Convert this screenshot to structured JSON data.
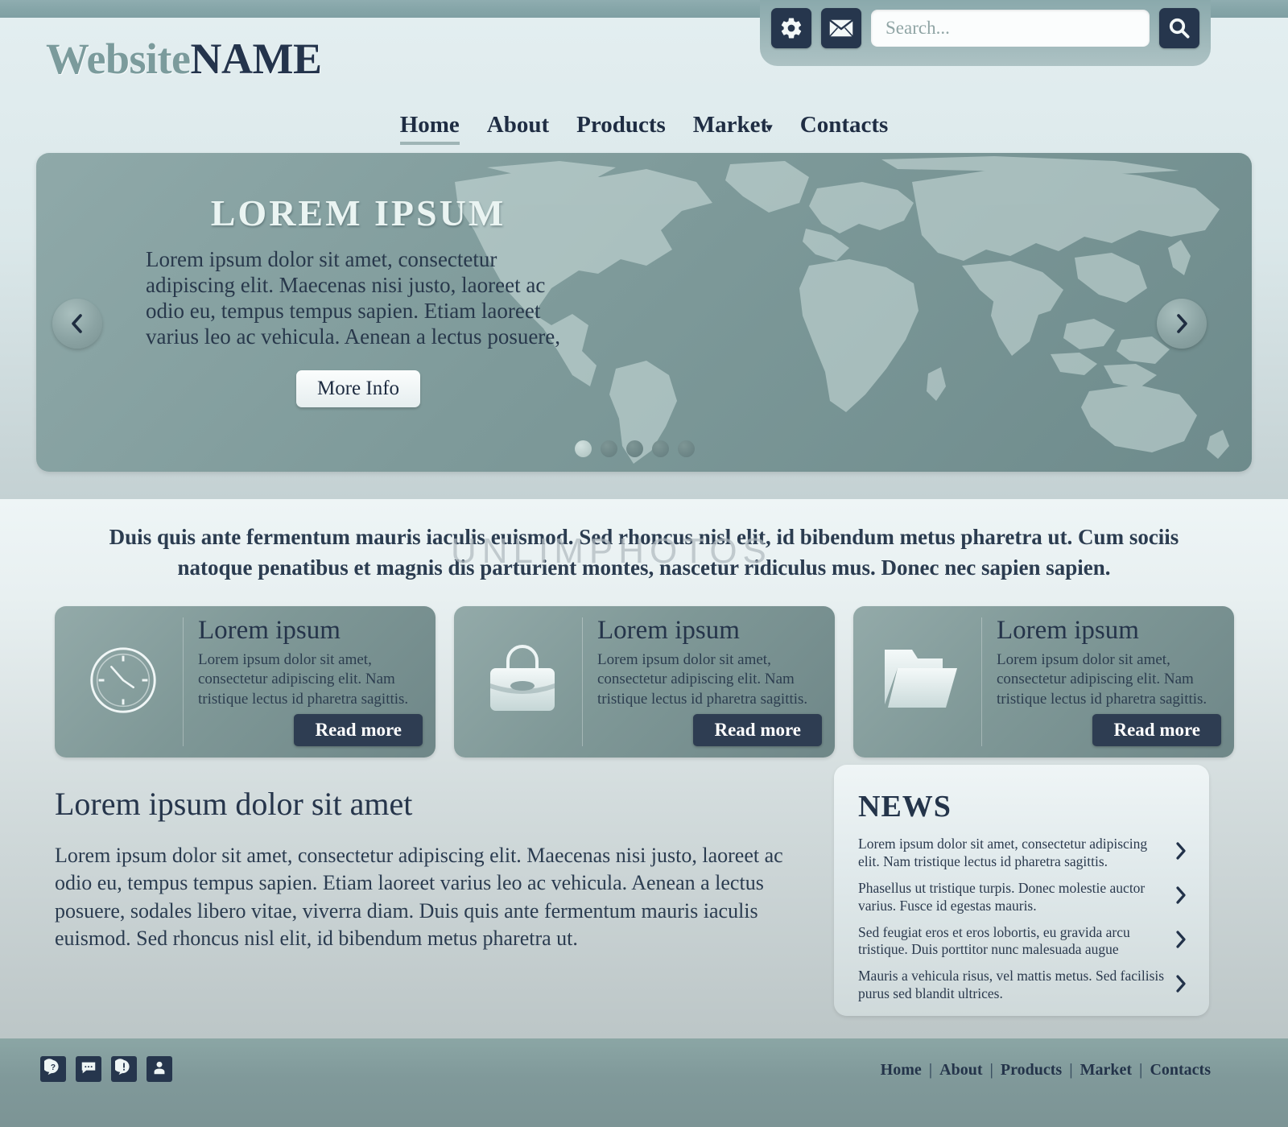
{
  "brand": {
    "logo_part_a": "Website",
    "logo_part_b": "NAME"
  },
  "header": {
    "gear_icon": "gear-icon",
    "mail_icon": "envelope-icon",
    "search_placeholder": "Search...",
    "search_value": "",
    "search_button_icon": "magnifier-icon"
  },
  "nav": {
    "items": [
      {
        "label": "Home",
        "active": true,
        "caret": ""
      },
      {
        "label": "About",
        "active": false,
        "caret": ""
      },
      {
        "label": "Products",
        "active": false,
        "caret": ""
      },
      {
        "label": "Market",
        "active": false,
        "caret": "▾"
      },
      {
        "label": "Contacts",
        "active": false,
        "caret": ""
      }
    ]
  },
  "hero": {
    "title": "LOREM IPSUM",
    "text": "Lorem ipsum dolor sit amet, consectetur adipiscing elit. Maecenas nisi justo, laoreet ac odio eu, tempus tempus sapien. Etiam laoreet varius leo ac vehicula. Aenean a lectus posuere,",
    "button_label": "More Info",
    "prev_icon": "chevron-left-icon",
    "next_icon": "chevron-right-icon",
    "dot_count": 5,
    "active_dot": 1,
    "background_image": "world-map"
  },
  "tagline": "Duis quis ante fermentum mauris iaculis euismod. Sed rhoncus nisl elit, id bibendum metus pharetra ut. Cum sociis natoque penatibus et magnis dis parturient montes, nascetur ridiculus mus. Donec nec sapien sapien.",
  "cards": [
    {
      "icon": "clock-icon",
      "title": "Lorem ipsum",
      "text": "Lorem ipsum dolor sit amet, consectetur adipiscing elit. Nam tristique lectus id pharetra sagittis.",
      "button_label": "Read more"
    },
    {
      "icon": "briefcase-icon",
      "title": "Lorem ipsum",
      "text": "Lorem ipsum dolor sit amet, consectetur adipiscing elit. Nam tristique lectus id pharetra sagittis.",
      "button_label": "Read more"
    },
    {
      "icon": "folder-icon",
      "title": "Lorem ipsum",
      "text": "Lorem ipsum dolor sit amet, consectetur adipiscing elit. Nam tristique lectus id pharetra sagittis.",
      "button_label": "Read more"
    }
  ],
  "article": {
    "title": "Lorem ipsum dolor sit amet",
    "text": "Lorem ipsum dolor sit amet, consectetur adipiscing elit. Maecenas nisi justo, laoreet ac odio eu, tempus tempus sapien. Etiam laoreet varius leo ac vehicula. Aenean a lectus posuere, sodales libero vitae, viverra diam. Duis quis ante fermentum mauris iaculis euismod. Sed rhoncus nisl elit, id bibendum metus pharetra ut."
  },
  "news": {
    "title": "NEWS",
    "items": [
      {
        "text": "Lorem ipsum dolor sit amet, consectetur adipiscing elit. Nam tristique lectus id pharetra sagittis.",
        "icon": "chevron-right-icon"
      },
      {
        "text": "Phasellus ut tristique turpis. Donec molestie auctor varius. Fusce id egestas mauris.",
        "icon": "chevron-right-icon"
      },
      {
        "text": "Sed feugiat eros et eros lobortis, eu gravida arcu tristique. Duis porttitor nunc malesuada augue",
        "icon": "chevron-right-icon"
      },
      {
        "text": "Mauris a vehicula risus, vel mattis metus. Sed facilisis purus sed blandit ultrices.",
        "icon": "chevron-right-icon"
      }
    ]
  },
  "footer": {
    "icons": [
      "help-icon",
      "chat-icon",
      "alert-icon",
      "user-icon"
    ],
    "nav": [
      {
        "label": "Home"
      },
      {
        "label": "About"
      },
      {
        "label": "Products"
      },
      {
        "label": "Market"
      },
      {
        "label": "Contacts"
      }
    ],
    "separator": "|"
  },
  "watermark": "UNLIMPHOTOS",
  "colors": {
    "accent_teal": "#86a5a8",
    "dark_navy": "#26364d",
    "panel_light": "#e8f0f1",
    "card_teal": "#7f9897",
    "text_dark": "#2b3c50"
  }
}
